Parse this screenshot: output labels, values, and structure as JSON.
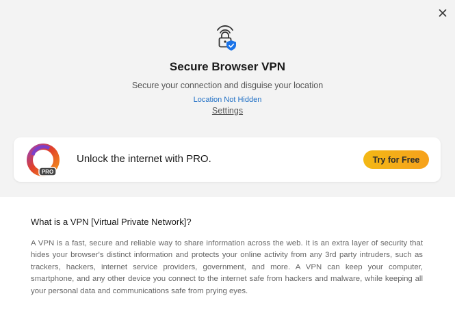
{
  "header": {
    "title": "Secure Browser VPN",
    "subtitle": "Secure your connection and disguise your location",
    "location_status": "Location Not Hidden",
    "settings_link": "Settings"
  },
  "icons": {
    "close": "close-icon",
    "hero": "lock-shield-icon",
    "pro_logo": "browser-pro-logo"
  },
  "promo": {
    "text": "Unlock the internet with PRO.",
    "button_label": "Try for Free",
    "badge": "PRO"
  },
  "info": {
    "title": "What is a VPN [Virtual Private Network]?",
    "body": "A VPN is a fast, secure and reliable way to share information across the web. It is an extra layer of security that hides your browser's distinct information and protects your online activity from any 3rd party intruders, such as trackers, hackers, internet service providers, government, and more. A VPN can keep your computer, smartphone, and any other device you connect to the internet safe from hackers and malware, while keeping all your personal data and communications safe from prying eyes."
  },
  "colors": {
    "accent_link": "#1f6fc5",
    "button": "#f5ad18",
    "shield": "#1a73e8",
    "top_bg": "#f3f3f3"
  }
}
